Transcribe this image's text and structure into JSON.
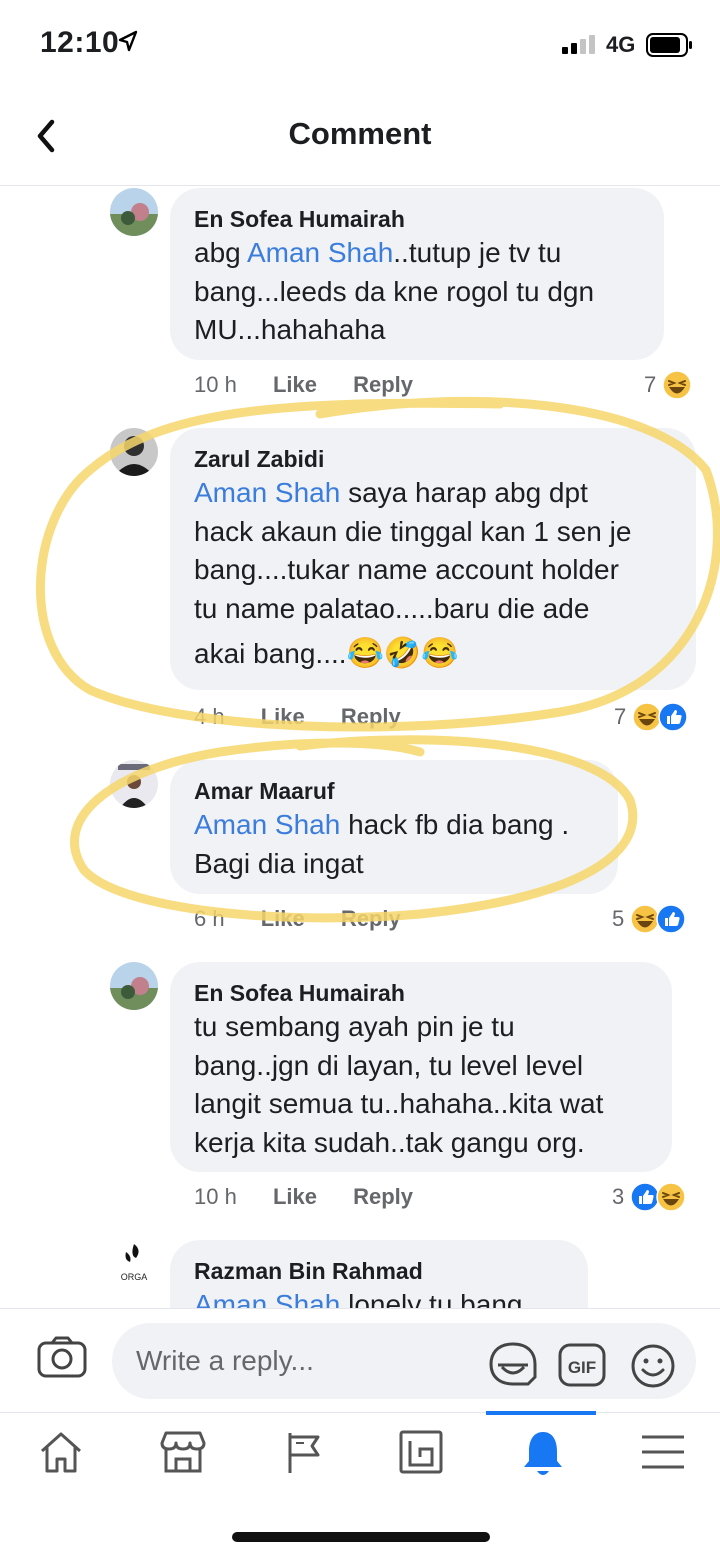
{
  "status_bar": {
    "time": "12:10",
    "network": "4G"
  },
  "header": {
    "title": "Comment"
  },
  "comments": [
    {
      "name": "En Sofea Humairah",
      "mention": "",
      "lines": [
        "abg ",
        "Aman Shah",
        "..tutup je tv tu",
        "bang...leeds da kne rogol tu dgn",
        "MU...hahahaha"
      ],
      "ago": "10 h",
      "like": "Like",
      "reply": "Reply",
      "reaction_count": "7"
    },
    {
      "name": "Zarul Zabidi",
      "mention": "Aman Shah",
      "lines": [
        " saya harap abg dpt",
        "hack akaun die tinggal kan 1 sen je",
        "bang....tukar name account holder",
        "tu name palatao.....baru die ade",
        "akai bang...."
      ],
      "emoji": "😂🤣😂",
      "ago": "4 h",
      "like": "Like",
      "reply": "Reply",
      "reaction_count": "7"
    },
    {
      "name": "Amar Maaruf",
      "mention": "Aman Shah",
      "lines": [
        " hack fb dia bang .",
        "Bagi dia ingat"
      ],
      "ago": "6 h",
      "like": "Like",
      "reply": "Reply",
      "reaction_count": "5"
    },
    {
      "name": "En Sofea Humairah",
      "mention": "",
      "lines": [
        "tu sembang ayah pin je tu",
        "bang..jgn di layan, tu level level",
        "langit semua tu..hahaha..kita wat",
        "kerja kita sudah..tak gangu org."
      ],
      "ago": "10 h",
      "like": "Like",
      "reply": "Reply",
      "reaction_count": "3"
    },
    {
      "name": "Razman Bin Rahmad",
      "mention": "Aman Shah",
      "lines": [
        " lonely tu bang"
      ],
      "avatar_text": "ORGA"
    }
  ],
  "composer": {
    "placeholder": "Write a reply...",
    "gif_label": "GIF"
  },
  "colors": {
    "mention": "#3b7ddd",
    "bubble": "#f0f2f5",
    "highlight": "#f6d66b",
    "active": "#1877f2"
  },
  "icons": [
    "back-icon",
    "camera-icon",
    "sticker-icon",
    "gif-icon",
    "emoji-icon",
    "home-icon",
    "marketplace-icon",
    "pages-icon",
    "groups-icon",
    "notifications-icon",
    "menu-icon"
  ]
}
